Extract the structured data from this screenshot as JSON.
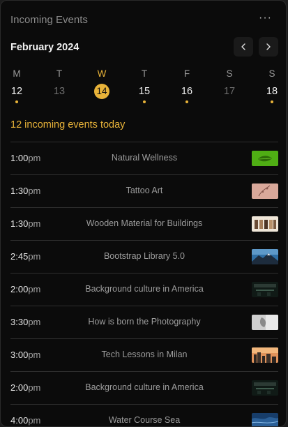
{
  "widget": {
    "title": "Incoming Events",
    "more_label": "···"
  },
  "calendar": {
    "month_label": "February 2024",
    "days": [
      {
        "dow": "M",
        "date": "12",
        "state": "normal",
        "has_event": true
      },
      {
        "dow": "T",
        "date": "13",
        "state": "muted",
        "has_event": false
      },
      {
        "dow": "W",
        "date": "14",
        "state": "today",
        "has_event": false
      },
      {
        "dow": "T",
        "date": "15",
        "state": "normal",
        "has_event": true
      },
      {
        "dow": "F",
        "date": "16",
        "state": "normal",
        "has_event": true
      },
      {
        "dow": "S",
        "date": "17",
        "state": "muted",
        "has_event": false
      },
      {
        "dow": "S",
        "date": "18",
        "state": "normal",
        "has_event": true
      }
    ]
  },
  "summary": "12 incoming events today",
  "events": [
    {
      "time": "1:00",
      "ampm": "pm",
      "title": "Natural Wellness",
      "thumb": "green-leaf"
    },
    {
      "time": "1:30",
      "ampm": "pm",
      "title": "Tattoo Art",
      "thumb": "tattoo"
    },
    {
      "time": "1:30",
      "ampm": "pm",
      "title": "Wooden Material for Buildings",
      "thumb": "wood"
    },
    {
      "time": "2:45",
      "ampm": "pm",
      "title": "Bootstrap Library 5.0",
      "thumb": "mountain"
    },
    {
      "time": "2:00",
      "ampm": "pm",
      "title": "Background culture in America",
      "thumb": "dark-room"
    },
    {
      "time": "3:30",
      "ampm": "pm",
      "title": "How is born the Photography",
      "thumb": "photo"
    },
    {
      "time": "3:00",
      "ampm": "pm",
      "title": "Tech Lessons in Milan",
      "thumb": "city-sunset"
    },
    {
      "time": "2:00",
      "ampm": "pm",
      "title": "Background culture in America",
      "thumb": "dark-room"
    },
    {
      "time": "4:00",
      "ampm": "pm",
      "title": "Water Course Sea",
      "thumb": "sea"
    }
  ],
  "colors": {
    "accent": "#e8b339",
    "panel": "#0b0b0b",
    "divider": "#2f2f2f"
  }
}
